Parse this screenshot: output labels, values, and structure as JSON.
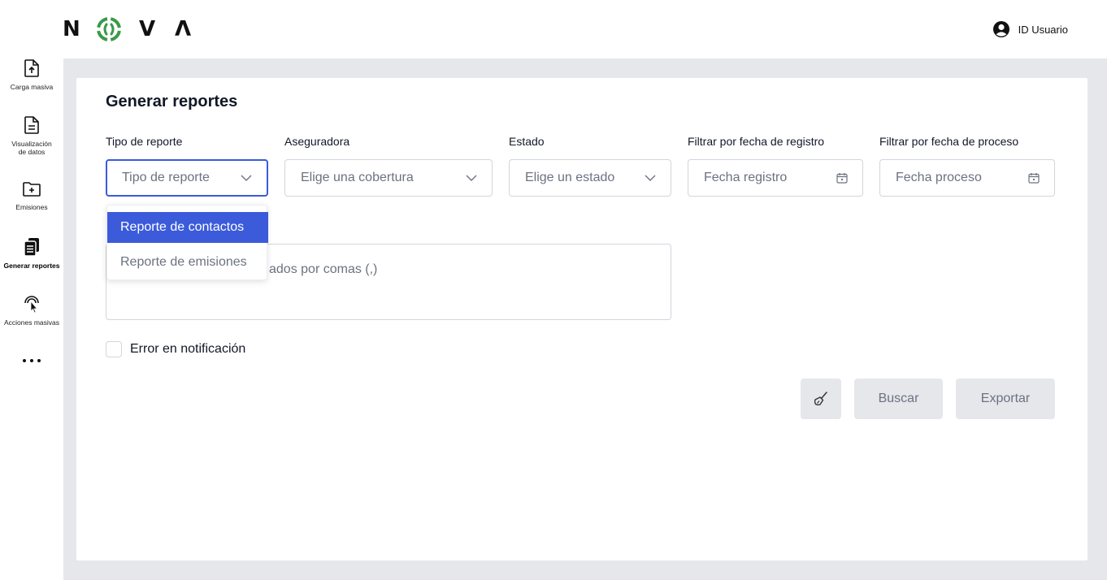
{
  "header": {
    "logo_letters": [
      "N",
      "O",
      "V",
      "Λ"
    ],
    "user_label": "ID Usuario",
    "user_icon": "user-circle-icon"
  },
  "sidebar": {
    "items": [
      {
        "label": "Carga masiva",
        "icon": "file-upload-icon"
      },
      {
        "label": "Visualización de datos",
        "icon": "document-icon"
      },
      {
        "label": "Emisiones",
        "icon": "folder-plus-icon"
      },
      {
        "label": "Generar reportes",
        "icon": "clipboard-list-icon",
        "active": true
      },
      {
        "label": "Acciones masivas",
        "icon": "touch-pointer-icon"
      }
    ],
    "more_icon": "more-dots-icon"
  },
  "main": {
    "title": "Generar reportes",
    "filters": {
      "tipo_reporte": {
        "label": "Tipo de reporte",
        "placeholder": "Tipo de reporte"
      },
      "aseguradora": {
        "label": "Aseguradora",
        "placeholder": "Elige una cobertura"
      },
      "estado": {
        "label": "Estado",
        "placeholder": "Elige un estado"
      },
      "fecha_registro": {
        "label": "Filtrar por fecha de registro",
        "placeholder": "Fecha registro"
      },
      "fecha_proceso": {
        "label": "Filtrar por fecha de proceso",
        "placeholder": "Fecha proceso"
      }
    },
    "textarea_visible_placeholder": "ados por comas (,)",
    "dropdown_options": [
      "Reporte de contactos",
      "Reporte de emisiones"
    ],
    "checkbox_label": "Error en notificación",
    "buttons": {
      "clear_icon": "broom-icon",
      "search": "Buscar",
      "export": "Exportar"
    },
    "colors": {
      "accent": "#3b5bdb",
      "logo_green": "#3a9a4a",
      "background": "#e5e7eb"
    }
  }
}
